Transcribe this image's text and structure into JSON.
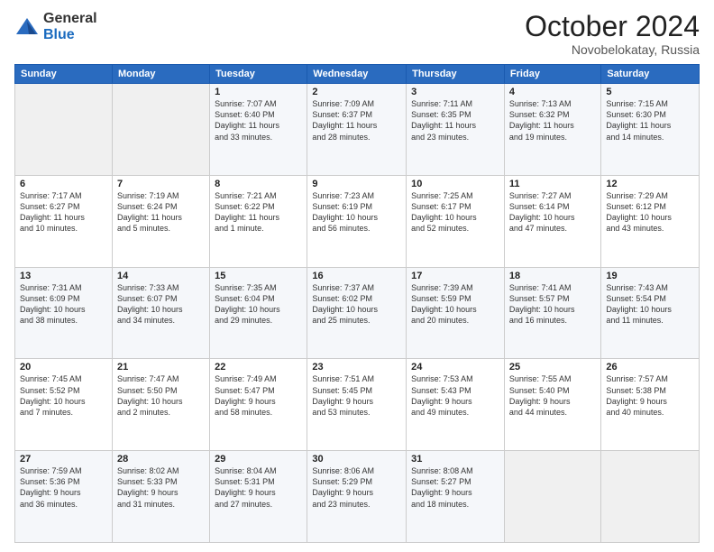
{
  "logo": {
    "general": "General",
    "blue": "Blue"
  },
  "header": {
    "month": "October 2024",
    "location": "Novobelokatay, Russia"
  },
  "days_of_week": [
    "Sunday",
    "Monday",
    "Tuesday",
    "Wednesday",
    "Thursday",
    "Friday",
    "Saturday"
  ],
  "weeks": [
    [
      {
        "num": "",
        "info": ""
      },
      {
        "num": "",
        "info": ""
      },
      {
        "num": "1",
        "info": "Sunrise: 7:07 AM\nSunset: 6:40 PM\nDaylight: 11 hours\nand 33 minutes."
      },
      {
        "num": "2",
        "info": "Sunrise: 7:09 AM\nSunset: 6:37 PM\nDaylight: 11 hours\nand 28 minutes."
      },
      {
        "num": "3",
        "info": "Sunrise: 7:11 AM\nSunset: 6:35 PM\nDaylight: 11 hours\nand 23 minutes."
      },
      {
        "num": "4",
        "info": "Sunrise: 7:13 AM\nSunset: 6:32 PM\nDaylight: 11 hours\nand 19 minutes."
      },
      {
        "num": "5",
        "info": "Sunrise: 7:15 AM\nSunset: 6:30 PM\nDaylight: 11 hours\nand 14 minutes."
      }
    ],
    [
      {
        "num": "6",
        "info": "Sunrise: 7:17 AM\nSunset: 6:27 PM\nDaylight: 11 hours\nand 10 minutes."
      },
      {
        "num": "7",
        "info": "Sunrise: 7:19 AM\nSunset: 6:24 PM\nDaylight: 11 hours\nand 5 minutes."
      },
      {
        "num": "8",
        "info": "Sunrise: 7:21 AM\nSunset: 6:22 PM\nDaylight: 11 hours\nand 1 minute."
      },
      {
        "num": "9",
        "info": "Sunrise: 7:23 AM\nSunset: 6:19 PM\nDaylight: 10 hours\nand 56 minutes."
      },
      {
        "num": "10",
        "info": "Sunrise: 7:25 AM\nSunset: 6:17 PM\nDaylight: 10 hours\nand 52 minutes."
      },
      {
        "num": "11",
        "info": "Sunrise: 7:27 AM\nSunset: 6:14 PM\nDaylight: 10 hours\nand 47 minutes."
      },
      {
        "num": "12",
        "info": "Sunrise: 7:29 AM\nSunset: 6:12 PM\nDaylight: 10 hours\nand 43 minutes."
      }
    ],
    [
      {
        "num": "13",
        "info": "Sunrise: 7:31 AM\nSunset: 6:09 PM\nDaylight: 10 hours\nand 38 minutes."
      },
      {
        "num": "14",
        "info": "Sunrise: 7:33 AM\nSunset: 6:07 PM\nDaylight: 10 hours\nand 34 minutes."
      },
      {
        "num": "15",
        "info": "Sunrise: 7:35 AM\nSunset: 6:04 PM\nDaylight: 10 hours\nand 29 minutes."
      },
      {
        "num": "16",
        "info": "Sunrise: 7:37 AM\nSunset: 6:02 PM\nDaylight: 10 hours\nand 25 minutes."
      },
      {
        "num": "17",
        "info": "Sunrise: 7:39 AM\nSunset: 5:59 PM\nDaylight: 10 hours\nand 20 minutes."
      },
      {
        "num": "18",
        "info": "Sunrise: 7:41 AM\nSunset: 5:57 PM\nDaylight: 10 hours\nand 16 minutes."
      },
      {
        "num": "19",
        "info": "Sunrise: 7:43 AM\nSunset: 5:54 PM\nDaylight: 10 hours\nand 11 minutes."
      }
    ],
    [
      {
        "num": "20",
        "info": "Sunrise: 7:45 AM\nSunset: 5:52 PM\nDaylight: 10 hours\nand 7 minutes."
      },
      {
        "num": "21",
        "info": "Sunrise: 7:47 AM\nSunset: 5:50 PM\nDaylight: 10 hours\nand 2 minutes."
      },
      {
        "num": "22",
        "info": "Sunrise: 7:49 AM\nSunset: 5:47 PM\nDaylight: 9 hours\nand 58 minutes."
      },
      {
        "num": "23",
        "info": "Sunrise: 7:51 AM\nSunset: 5:45 PM\nDaylight: 9 hours\nand 53 minutes."
      },
      {
        "num": "24",
        "info": "Sunrise: 7:53 AM\nSunset: 5:43 PM\nDaylight: 9 hours\nand 49 minutes."
      },
      {
        "num": "25",
        "info": "Sunrise: 7:55 AM\nSunset: 5:40 PM\nDaylight: 9 hours\nand 44 minutes."
      },
      {
        "num": "26",
        "info": "Sunrise: 7:57 AM\nSunset: 5:38 PM\nDaylight: 9 hours\nand 40 minutes."
      }
    ],
    [
      {
        "num": "27",
        "info": "Sunrise: 7:59 AM\nSunset: 5:36 PM\nDaylight: 9 hours\nand 36 minutes."
      },
      {
        "num": "28",
        "info": "Sunrise: 8:02 AM\nSunset: 5:33 PM\nDaylight: 9 hours\nand 31 minutes."
      },
      {
        "num": "29",
        "info": "Sunrise: 8:04 AM\nSunset: 5:31 PM\nDaylight: 9 hours\nand 27 minutes."
      },
      {
        "num": "30",
        "info": "Sunrise: 8:06 AM\nSunset: 5:29 PM\nDaylight: 9 hours\nand 23 minutes."
      },
      {
        "num": "31",
        "info": "Sunrise: 8:08 AM\nSunset: 5:27 PM\nDaylight: 9 hours\nand 18 minutes."
      },
      {
        "num": "",
        "info": ""
      },
      {
        "num": "",
        "info": ""
      }
    ]
  ]
}
